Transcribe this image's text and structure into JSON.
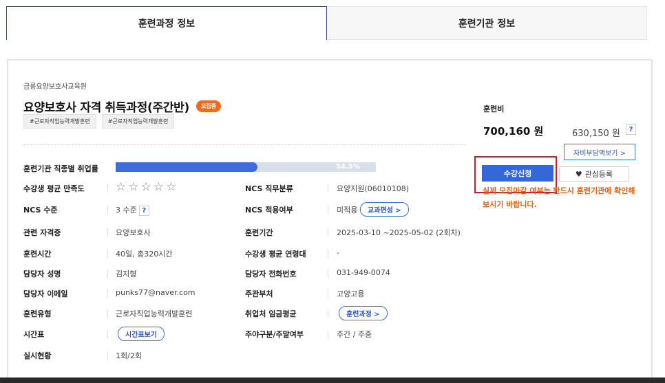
{
  "tabs": [
    {
      "label": "훈련과정 정보",
      "active": true
    },
    {
      "label": "훈련기관 정보",
      "active": false
    }
  ],
  "course": {
    "org": "금릉요양보호사교육원",
    "title": "요양보호사 자격 취득과정(주간반)",
    "status_badge": "모집중",
    "tags": [
      "#근로자직업능력개발훈련",
      "#근로자직업능력개발훈련"
    ]
  },
  "details": {
    "employment_rate": {
      "label": "훈련기관 직종별 취업률",
      "value": "54.5%",
      "percent": 54.5
    },
    "satisfaction": {
      "label": "수강생 평균 만족도",
      "stars": "☆☆☆☆☆",
      "rating": 0,
      "max": 5
    },
    "ncs_category": {
      "label": "NCS 직무분류",
      "value": "요양지원(06010108)"
    },
    "ncs_level": {
      "label": "NCS 수준",
      "value": "3 수준",
      "help": "?"
    },
    "ncs_applied": {
      "label": "NCS 적용여부",
      "value": "미적용",
      "button": "교과편성 >"
    },
    "certificate": {
      "label": "관련 자격증",
      "value": "요양보호사"
    },
    "period": {
      "label": "훈련기간",
      "value": "2025-03-10 ~2025-05-02 (2회차)"
    },
    "hours": {
      "label": "훈련시간",
      "value": "40일, 총320시간"
    },
    "age": {
      "label": "수강생 평균 연령대",
      "value": "-"
    },
    "manager": {
      "label": "담당자 성명",
      "value": "김지형"
    },
    "phone": {
      "label": "담당자 전화번호",
      "value": "031-949-0074"
    },
    "email": {
      "label": "담당자 이메일",
      "value": "punks77@naver.com"
    },
    "ministry": {
      "label": "주관부처",
      "value": "고양고용"
    },
    "type": {
      "label": "훈련유형",
      "value": "근로자직업능력개발훈련"
    },
    "wage": {
      "label": "취업처 임금평균",
      "button": "훈련과정 >"
    },
    "schedule": {
      "label": "시간표",
      "button": "시간표보기"
    },
    "day_night": {
      "label": "주야구분/주말여부",
      "value": "주간 / 주중"
    },
    "status": {
      "label": "실시현황",
      "value": "1회/2회"
    }
  },
  "fee": {
    "label": "훈련비",
    "main": "700,160 원",
    "sub": "630,150 원",
    "help": "?",
    "selfpay_button": "자비부담액보기 >"
  },
  "actions": {
    "apply": "수강신청",
    "interest": "관심등록",
    "heart": "♥",
    "notice": "실제 모집마감 여부는 반드시 훈련기관에 확인해보시기 바랍니다."
  },
  "colors": {
    "accent": "#3468d8",
    "badge": "#f26a1b",
    "notice": "#ef5b0c",
    "highlight": "#e0141e"
  }
}
